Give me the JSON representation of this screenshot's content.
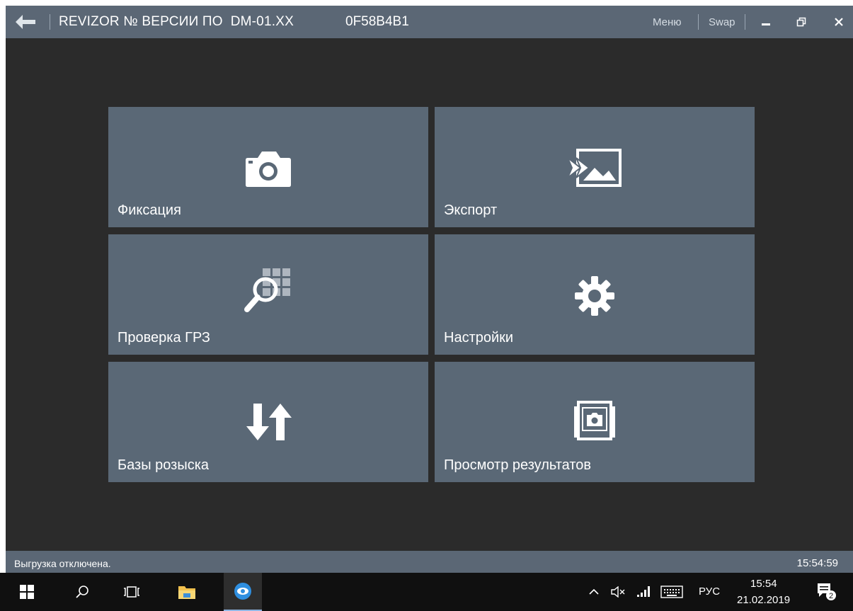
{
  "window": {
    "title": "REVIZOR № ВЕРСИИ ПО  DM-01.XX",
    "serial": "0F58B4B1",
    "menu_label": "Меню",
    "swap_label": "Swap"
  },
  "tiles": [
    {
      "label": "Фиксация",
      "icon": "camera-icon"
    },
    {
      "label": "Экспорт",
      "icon": "export-image-icon"
    },
    {
      "label": "Проверка ГРЗ",
      "icon": "plate-search-icon"
    },
    {
      "label": "Настройки",
      "icon": "gear-icon"
    },
    {
      "label": "Базы розыска",
      "icon": "up-down-arrows-icon"
    },
    {
      "label": "Просмотр результатов",
      "icon": "photo-gallery-icon"
    }
  ],
  "status": {
    "text": "Выгрузка отключена.",
    "time": "15:54:59"
  },
  "taskbar": {
    "language": "РУС",
    "time": "15:54",
    "date": "21.02.2019",
    "notifications": "2"
  },
  "colors": {
    "titlebar": "#5b6775",
    "tile": "#5a6876",
    "background": "#2b2b2b",
    "taskbar": "#101010"
  }
}
